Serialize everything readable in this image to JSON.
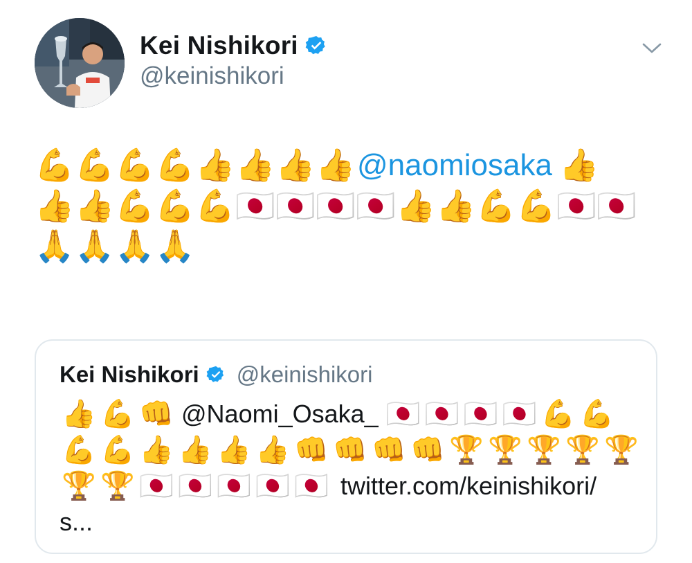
{
  "author": {
    "display_name": "Kei Nishikori",
    "handle": "@keinishikori",
    "verified": true
  },
  "tweet": {
    "lines": [
      {
        "emojis_before": [
          "💪",
          "💪",
          "💪",
          "💪",
          "👍",
          "👍",
          "👍",
          "👍"
        ],
        "mention": "@naomiosaka",
        "emojis_after": [
          "👍"
        ]
      },
      {
        "emojis": [
          "👍",
          "👍",
          "💪",
          "💪",
          "💪",
          "🇯🇵",
          "🇯🇵",
          "🇯🇵",
          "🇯🇵",
          "👍",
          "👍",
          "💪",
          "💪",
          "🇯🇵",
          "🇯🇵"
        ]
      },
      {
        "emojis": [
          "🙏",
          "🙏",
          "🙏",
          "🙏"
        ]
      }
    ]
  },
  "quoted_tweet": {
    "display_name": "Kei Nishikori",
    "handle": "@keinishikori",
    "verified": true,
    "line1": {
      "emojis_before": [
        "👍",
        "💪",
        "👊"
      ],
      "mention": "@Naomi_Osaka_",
      "emojis_after": [
        "🇯🇵",
        "🇯🇵",
        "🇯🇵",
        "🇯🇵",
        "💪",
        "💪"
      ]
    },
    "line2": {
      "emojis": [
        "💪",
        "💪",
        "👍",
        "👍",
        "👍",
        "👍",
        "👊",
        "👊",
        "👊",
        "👊",
        "🏆",
        "🏆",
        "🏆",
        "🏆",
        "🏆"
      ]
    },
    "line3": {
      "emojis": [
        "🏆",
        "🏆",
        "🇯🇵",
        "🇯🇵",
        "🇯🇵",
        "🇯🇵",
        "🇯🇵"
      ],
      "link": "twitter.com/keinishikori/"
    },
    "line4": "s..."
  },
  "icons": {
    "verified": "verified-badge-icon",
    "menu_caret": "chevron-down-icon"
  },
  "colors": {
    "mention": "#1b95e0",
    "verified": "#1da1f2",
    "secondary_text": "#657786",
    "border": "#e1e8ed"
  }
}
